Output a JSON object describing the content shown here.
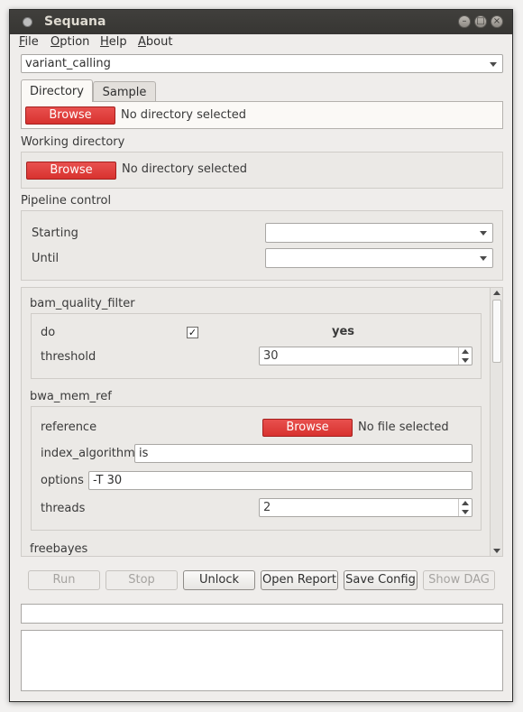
{
  "window": {
    "title": "Sequana"
  },
  "menu": {
    "file": "F",
    "file_rest": "ile",
    "option": "O",
    "option_rest": "ption",
    "help": "H",
    "help_rest": "elp",
    "about": "A",
    "about_rest": "bout"
  },
  "pipeline_selector": {
    "value": "variant_calling"
  },
  "tabs": [
    {
      "label": "Directory"
    },
    {
      "label": "Sample"
    }
  ],
  "input_directory": {
    "browse": "Browse",
    "status": "No directory selected"
  },
  "working_directory": {
    "title": "Working directory",
    "browse": "Browse",
    "status": "No directory selected"
  },
  "pipeline_control": {
    "title": "Pipeline control",
    "starting_label": "Starting",
    "starting_value": "",
    "until_label": "Until",
    "until_value": ""
  },
  "config": {
    "bam_quality_filter": {
      "title": "bam_quality_filter",
      "do_label": "do",
      "do_checked": "✓",
      "do_value": "yes",
      "threshold_label": "threshold",
      "threshold_value": "30"
    },
    "bwa_mem_ref": {
      "title": "bwa_mem_ref",
      "reference_label": "reference",
      "browse": "Browse",
      "reference_status": "No file selected",
      "index_algorithm_label": "index_algorithm",
      "index_algorithm_value": "is",
      "options_label": "options",
      "options_value": "-T 30",
      "threads_label": "threads",
      "threads_value": "2"
    },
    "freebayes": {
      "title": "freebayes"
    }
  },
  "buttons": {
    "run": "Run",
    "stop": "Stop",
    "unlock": "Unlock",
    "open_report": "Open Report",
    "save_config": "Save Config",
    "show_dag": "Show DAG"
  },
  "colors": {
    "browse_red": "#dc3834",
    "titlebar": "#3c3b37"
  }
}
